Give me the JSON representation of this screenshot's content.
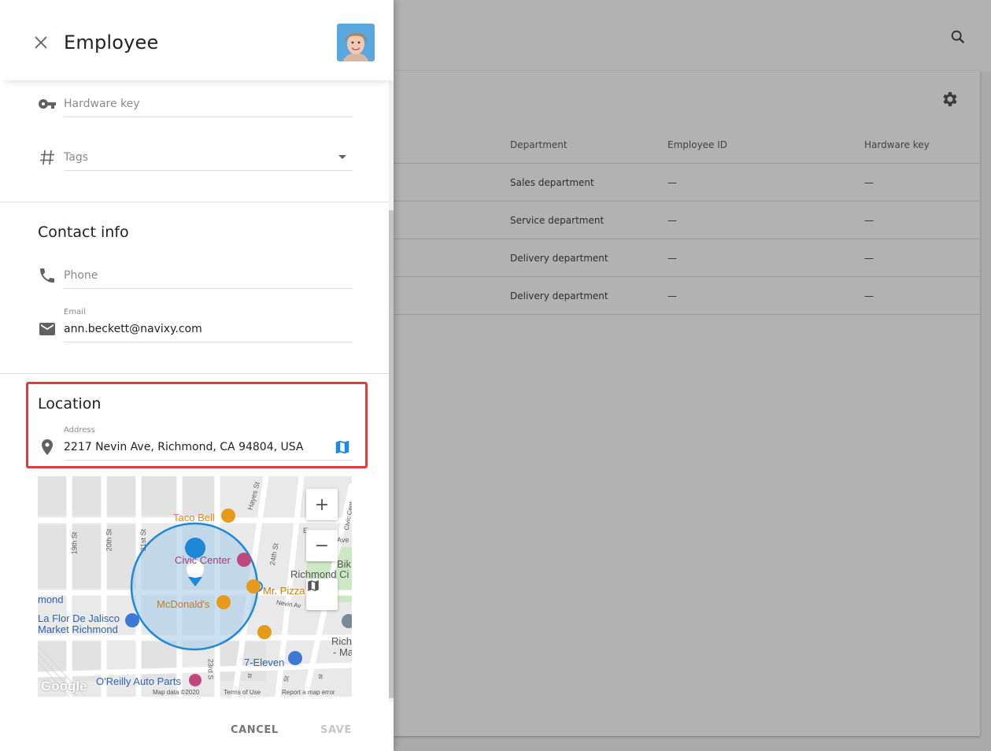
{
  "drawer": {
    "title": "Employee",
    "fields_top": {
      "hardware_key_placeholder": "Hardware key",
      "tags_placeholder": "Tags"
    },
    "contact": {
      "title": "Contact info",
      "phone_placeholder": "Phone",
      "email_label": "Email",
      "email_value": "ann.beckett@navixy.com"
    },
    "location": {
      "title": "Location",
      "address_label": "Address",
      "address_value": "2217 Nevin Ave, Richmond, CA 94804, USA"
    },
    "map": {
      "places": {
        "taco_bell": "Taco Bell",
        "civic_center": "Civic Center",
        "mcdonalds": "McDonald's",
        "mr_pizza": "Mr. Pizza",
        "la_flor": "La Flor De Jalisco",
        "market_richmond": "Market Richmond",
        "richmond_left": "mond",
        "seven_eleven": "7-Eleven",
        "oreilly": "O'Reilly Auto Parts",
        "richmond_ci": "Richmond Ci",
        "bik": "Bik",
        "rich_ma_1": "Rich",
        "rich_ma_2": "- Ma",
        "e_label": "E",
        "ave_label": "Ave"
      },
      "streets": {
        "s19": "19th St",
        "s20": "20th St",
        "s21": "21st St",
        "s23": "23rd S",
        "s24": "24th St",
        "hayes": "Hayes St",
        "civic_cent": "Civic Cent",
        "nevin": "Nevin Av",
        "st_a": "st",
        "st_b": "St",
        "st_c": "st"
      },
      "zoom_in": "+",
      "zoom_out": "−",
      "google": "Google",
      "map_data": "Map data ©2020",
      "terms": "Terms of Use",
      "report": "Report a map error"
    },
    "actions": {
      "cancel": "CANCEL",
      "save": "SAVE"
    }
  },
  "background_table": {
    "headers": {
      "department": "Department",
      "employee_id": "Employee ID",
      "hardware_key": "Hardware key"
    },
    "rows": [
      {
        "department": "Sales department",
        "employee_id": "—",
        "hardware_key": "—"
      },
      {
        "department": "Service department",
        "employee_id": "—",
        "hardware_key": "—"
      },
      {
        "department": "Delivery department",
        "employee_id": "—",
        "hardware_key": "—"
      },
      {
        "department": "Delivery department",
        "employee_id": "—",
        "hardware_key": "—"
      }
    ]
  },
  "colors": {
    "accent": "#1e88e5",
    "highlight_border": "#e03c3c",
    "radius_fill": "#a9cbe8",
    "radius_stroke": "#1e88d6",
    "poi_orange": "#e59a1a",
    "poi_pink": "#c2477e",
    "poi_blue": "#3e79d6"
  }
}
